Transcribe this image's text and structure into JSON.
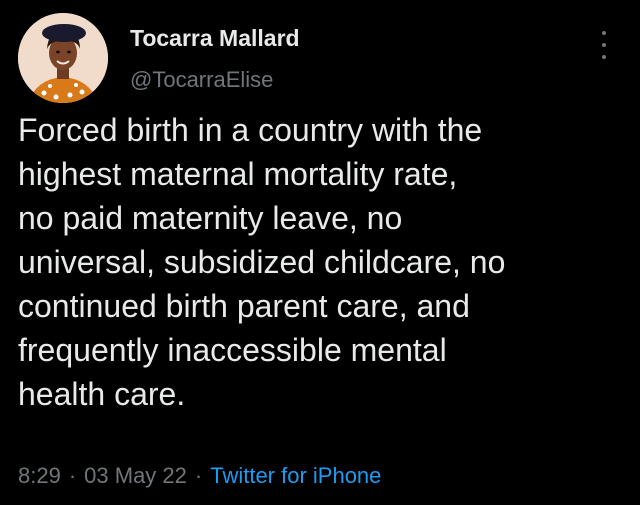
{
  "tweet": {
    "author": {
      "display_name": "Tocarra Mallard",
      "handle": "@TocarraElise",
      "avatar_icon": "profile-photo"
    },
    "text_lines": [
      "Forced birth in a country with the",
      "highest maternal mortality rate,",
      "no paid maternity leave, no",
      "universal, subsidized childcare, no",
      "continued birth parent care, and",
      "frequently inaccessible mental",
      "health care."
    ],
    "meta": {
      "time": "8:29",
      "date": "03 May 22",
      "separator": "·",
      "source": "Twitter for iPhone"
    },
    "more_icon": "more-vertical-icon"
  },
  "colors": {
    "background": "#000000",
    "text_primary": "#e7e9ea",
    "text_secondary": "#71767b",
    "link": "#1d9bf0"
  }
}
